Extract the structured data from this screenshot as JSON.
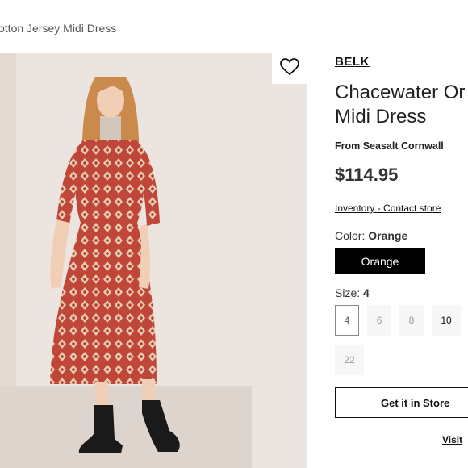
{
  "breadcrumb": "otton Jersey Midi Dress",
  "product": {
    "brand": "BELK",
    "title_line1": "Chacewater Or",
    "title_line2": "Midi Dress",
    "from": "From Seasalt Cornwall",
    "price": "$114.95",
    "inventory_link": "Inventory - Contact store"
  },
  "color": {
    "label": "Color:",
    "value": "Orange",
    "button_label": "Orange"
  },
  "size": {
    "label": "Size:",
    "value": "4",
    "options": [
      {
        "label": "4",
        "state": "selected"
      },
      {
        "label": "6",
        "state": "unavailable"
      },
      {
        "label": "8",
        "state": "unavailable"
      },
      {
        "label": "10",
        "state": "available"
      },
      {
        "label": "22",
        "state": "unavailable"
      }
    ]
  },
  "actions": {
    "get_in_store": "Get it in Store",
    "visit": "Visit"
  },
  "icons": {
    "wishlist": "heart-icon"
  },
  "colors": {
    "dress": "#c0463a",
    "button_dark": "#000000",
    "photo_bg": "#ece4de"
  }
}
